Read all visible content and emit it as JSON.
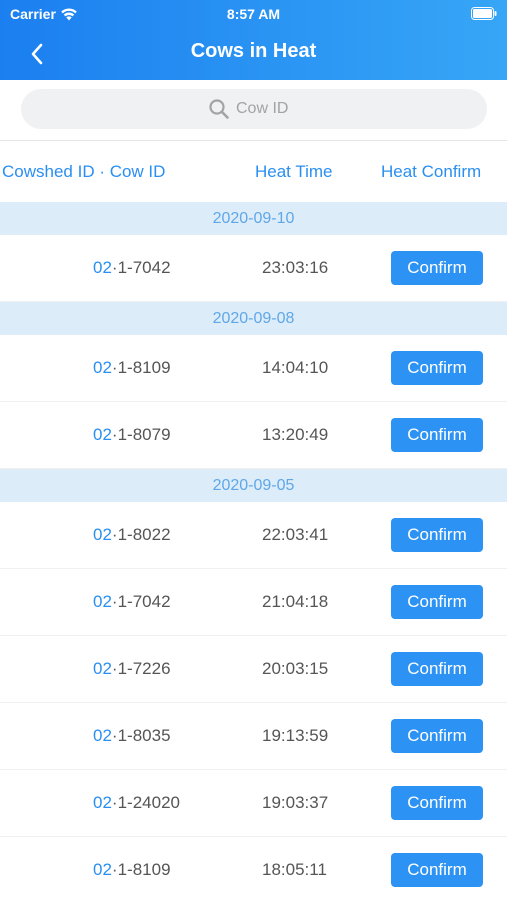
{
  "status_bar": {
    "carrier": "Carrier",
    "time": "8:57 AM"
  },
  "nav": {
    "title": "Cows in Heat"
  },
  "search": {
    "placeholder": "Cow ID",
    "value": ""
  },
  "columns": {
    "cow": "Cowshed ID · Cow ID",
    "time": "Heat Time",
    "confirm": "Heat Confirm"
  },
  "groups": [
    {
      "date": "2020-09-10",
      "rows": [
        {
          "shed": "02",
          "cow": "·1-7042",
          "time": "23:03:16",
          "action": "Confirm"
        }
      ]
    },
    {
      "date": "2020-09-08",
      "rows": [
        {
          "shed": "02",
          "cow": "·1-8109",
          "time": "14:04:10",
          "action": "Confirm"
        },
        {
          "shed": "02",
          "cow": "·1-8079",
          "time": "13:20:49",
          "action": "Confirm"
        }
      ]
    },
    {
      "date": "2020-09-05",
      "rows": [
        {
          "shed": "02",
          "cow": "·1-8022",
          "time": "22:03:41",
          "action": "Confirm"
        },
        {
          "shed": "02",
          "cow": "·1-7042",
          "time": "21:04:18",
          "action": "Confirm"
        },
        {
          "shed": "02",
          "cow": "·1-7226",
          "time": "20:03:15",
          "action": "Confirm"
        },
        {
          "shed": "02",
          "cow": "·1-8035",
          "time": "19:13:59",
          "action": "Confirm"
        },
        {
          "shed": "02",
          "cow": "·1-24020",
          "time": "19:03:37",
          "action": "Confirm"
        },
        {
          "shed": "02",
          "cow": "·1-8109",
          "time": "18:05:11",
          "action": "Confirm"
        }
      ]
    }
  ],
  "colors": {
    "accent": "#2c93f5",
    "header_start": "#1b7ff0",
    "header_end": "#37a6f6",
    "date_band": "#dcecf8"
  },
  "icons": {
    "back": "chevron-left-icon",
    "search": "search-icon",
    "wifi": "wifi-icon",
    "battery": "battery-icon"
  }
}
